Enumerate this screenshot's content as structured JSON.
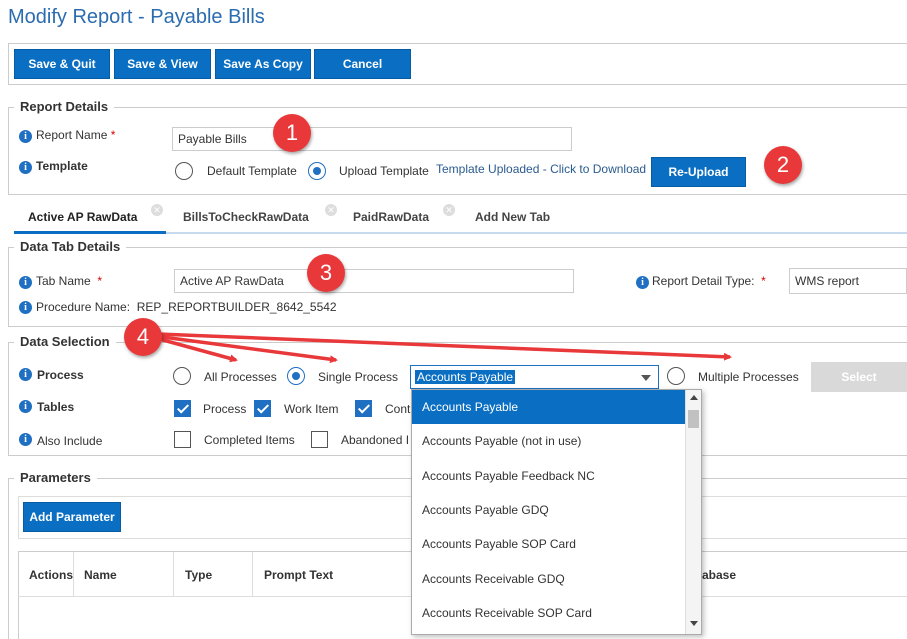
{
  "page_title": "Modify Report - Payable Bills",
  "toolbar": {
    "save_quit": "Save & Quit",
    "save_view": "Save & View",
    "save_copy": "Save As Copy",
    "cancel": "Cancel"
  },
  "report_details": {
    "title": "Report Details",
    "report_name_label": "Report Name",
    "report_name_req": "*",
    "report_name_value": "Payable Bills",
    "template_label": "Template",
    "default_template": "Default Template",
    "upload_template": "Upload Template",
    "uploaded_text": "Template Uploaded - Click to Download",
    "reupload": "Re-Upload"
  },
  "tabs": [
    {
      "label": "Active AP RawData"
    },
    {
      "label": "BillsToCheckRawData"
    },
    {
      "label": "PaidRawData"
    },
    {
      "label": "Add New Tab"
    }
  ],
  "data_tab": {
    "title": "Data Tab Details",
    "tab_name_label": "Tab Name",
    "tab_name_req": "*",
    "tab_name_value": "Active AP RawData",
    "detail_type_label": "Report Detail Type:",
    "detail_type_req": "*",
    "detail_type_value": "WMS report",
    "procedure_label": "Procedure Name:",
    "procedure_value": "REP_REPORTBUILDER_8642_5542"
  },
  "data_selection": {
    "title": "Data Selection",
    "process_label": "Process",
    "all_processes": "All Processes",
    "single_process": "Single Process",
    "selected_process": "Accounts Payable",
    "multiple_processes": "Multiple Processes",
    "select_btn": "Select",
    "tables_label": "Tables",
    "tables": [
      "Process",
      "Work Item",
      "Cont"
    ],
    "also_include_label": "Also Include",
    "also_include": [
      "Completed Items",
      "Abandoned I"
    ]
  },
  "dropdown_options": [
    "Accounts Payable",
    "Accounts Payable (not in use)",
    "Accounts Payable Feedback NC",
    "Accounts Payable GDQ",
    "Accounts Payable SOP Card",
    "Accounts Receivable GDQ",
    "Accounts Receivable SOP Card"
  ],
  "parameters": {
    "title": "Parameters",
    "add_btn": "Add Parameter",
    "columns": [
      "Actions",
      "Name",
      "Type",
      "Prompt Text",
      "abase"
    ]
  },
  "annotations": [
    "1",
    "2",
    "3",
    "4"
  ],
  "colors": {
    "accent": "#0a6fc2",
    "annotation": "#e8383a",
    "title": "#2b6cb0"
  }
}
